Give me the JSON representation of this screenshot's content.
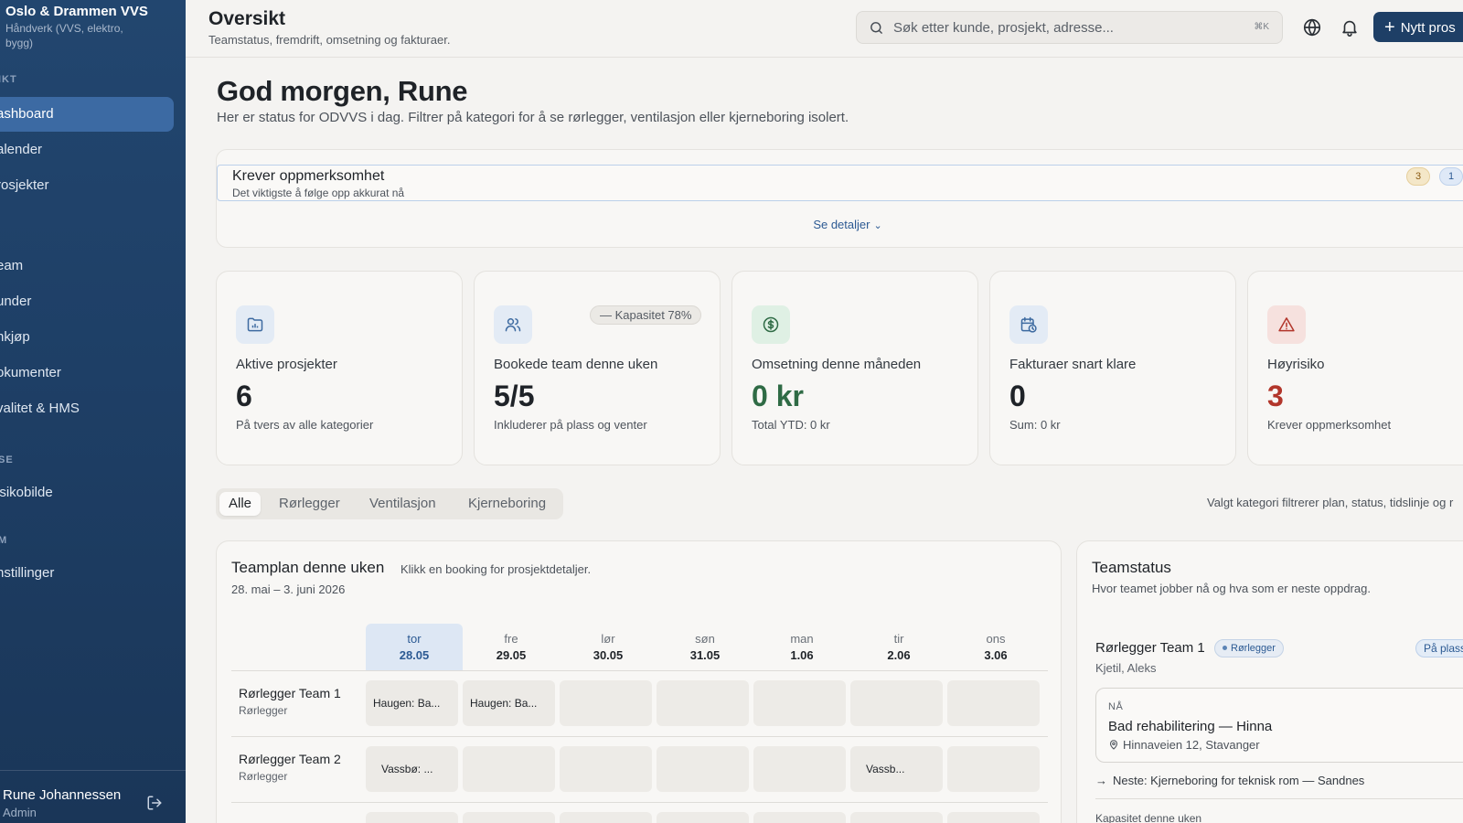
{
  "sidebar": {
    "brand_name": "Oslo & Drammen VVS",
    "brand_sub": "Håndverk (VVS, elektro, bygg)",
    "section_overview": "IKT",
    "items": [
      {
        "label": "ashboard",
        "active": true
      },
      {
        "label": "alender"
      },
      {
        "label": "rosjekter"
      },
      {
        "label": "eam"
      },
      {
        "label": "under"
      },
      {
        "label": "nkjøp"
      },
      {
        "label": "okumenter"
      },
      {
        "label": "valitet & HMS"
      },
      {
        "label": "isikobilde"
      },
      {
        "label": "nstillinger"
      }
    ],
    "section_analysis": "SE",
    "section_system": "M",
    "user_name": "Rune Johannessen",
    "user_role": "Admin"
  },
  "topbar": {
    "title": "Oversikt",
    "subtitle": "Teamstatus, fremdrift, omsetning og fakturaer.",
    "search_placeholder": "Søk etter kunde, prosjekt, adresse...",
    "search_shortcut": "⌘K",
    "new_button": "Nytt pros"
  },
  "greeting": {
    "title": "God morgen, Rune",
    "subtitle": "Her er status for ODVVS i dag. Filtrer på kategori for å se rørlegger, ventilasjon eller kjerneboring isolert."
  },
  "attention": {
    "title": "Krever oppmerksomhet",
    "subtitle": "Det viktigste å følge opp akkurat nå",
    "warn_count": "3",
    "info_count": "1",
    "details_link": "Se detaljer"
  },
  "kpis": [
    {
      "label": "Aktive prosjekter",
      "value": "6",
      "note": "På tvers av alle kategorier",
      "icon": "folder-chart-icon"
    },
    {
      "label": "Bookede team denne uken",
      "value": "5/5",
      "note": "Inkluderer på plass og venter",
      "icon": "users-icon",
      "pill": "— Kapasitet 78%"
    },
    {
      "label": "Omsetning denne måneden",
      "value": "0 kr",
      "note": "Total YTD: 0 kr",
      "icon": "dollar-circle-icon"
    },
    {
      "label": "Fakturaer snart klare",
      "value": "0",
      "note": "Sum: 0 kr",
      "icon": "calendar-clock-icon"
    },
    {
      "label": "Høyrisiko",
      "value": "3",
      "note": "Krever oppmerksomhet",
      "icon": "warning-icon"
    }
  ],
  "colors": {
    "accent": "#1e3f66",
    "revenue": "#2f6b45",
    "risk": "#b2362b"
  },
  "category_tabs": [
    "Alle",
    "Rørlegger",
    "Ventilasjon",
    "Kjerneboring"
  ],
  "filter_note": "Valgt kategori filtrerer plan, status, tidslinje og r",
  "team_plan": {
    "title": "Teamplan denne uken",
    "hint": "Klikk en booking for prosjektdetaljer.",
    "range": "28. mai – 3. juni 2026",
    "days": [
      {
        "name": "tor",
        "date": "28.05"
      },
      {
        "name": "fre",
        "date": "29.05"
      },
      {
        "name": "lør",
        "date": "30.05"
      },
      {
        "name": "søn",
        "date": "31.05"
      },
      {
        "name": "man",
        "date": "1.06"
      },
      {
        "name": "tir",
        "date": "2.06"
      },
      {
        "name": "ons",
        "date": "3.06"
      }
    ],
    "rows": [
      {
        "name": "Rørlegger Team 1",
        "category": "Rørlegger",
        "cells": [
          "Haugen: Ba...",
          "Haugen: Ba...",
          "",
          "",
          "",
          "",
          ""
        ]
      },
      {
        "name": "Rørlegger Team 2",
        "category": "Rørlegger",
        "cells": [
          "Vassbø: ...",
          "",
          "",
          "",
          "",
          "Vassb...",
          ""
        ]
      },
      {
        "name": "",
        "category": "",
        "cells": [
          "",
          "",
          "",
          "",
          "",
          "",
          ""
        ]
      }
    ]
  },
  "team_status": {
    "title": "Teamstatus",
    "subtitle": "Hvor teamet jobber nå og hva som er neste oppdrag.",
    "team_name": "Rørlegger Team 1",
    "team_badge": "Rørlegger",
    "onsite": "På plass",
    "members": "Kjetil, Aleks",
    "now_label": "NÅ",
    "now_job": "Bad rehabilitering — Hinna",
    "now_address": "Hinnaveien 12, Stavanger",
    "next": "Neste: Kjerneboring for teknisk rom — Sandnes",
    "capacity_label": "Kapasitet denne uken"
  }
}
